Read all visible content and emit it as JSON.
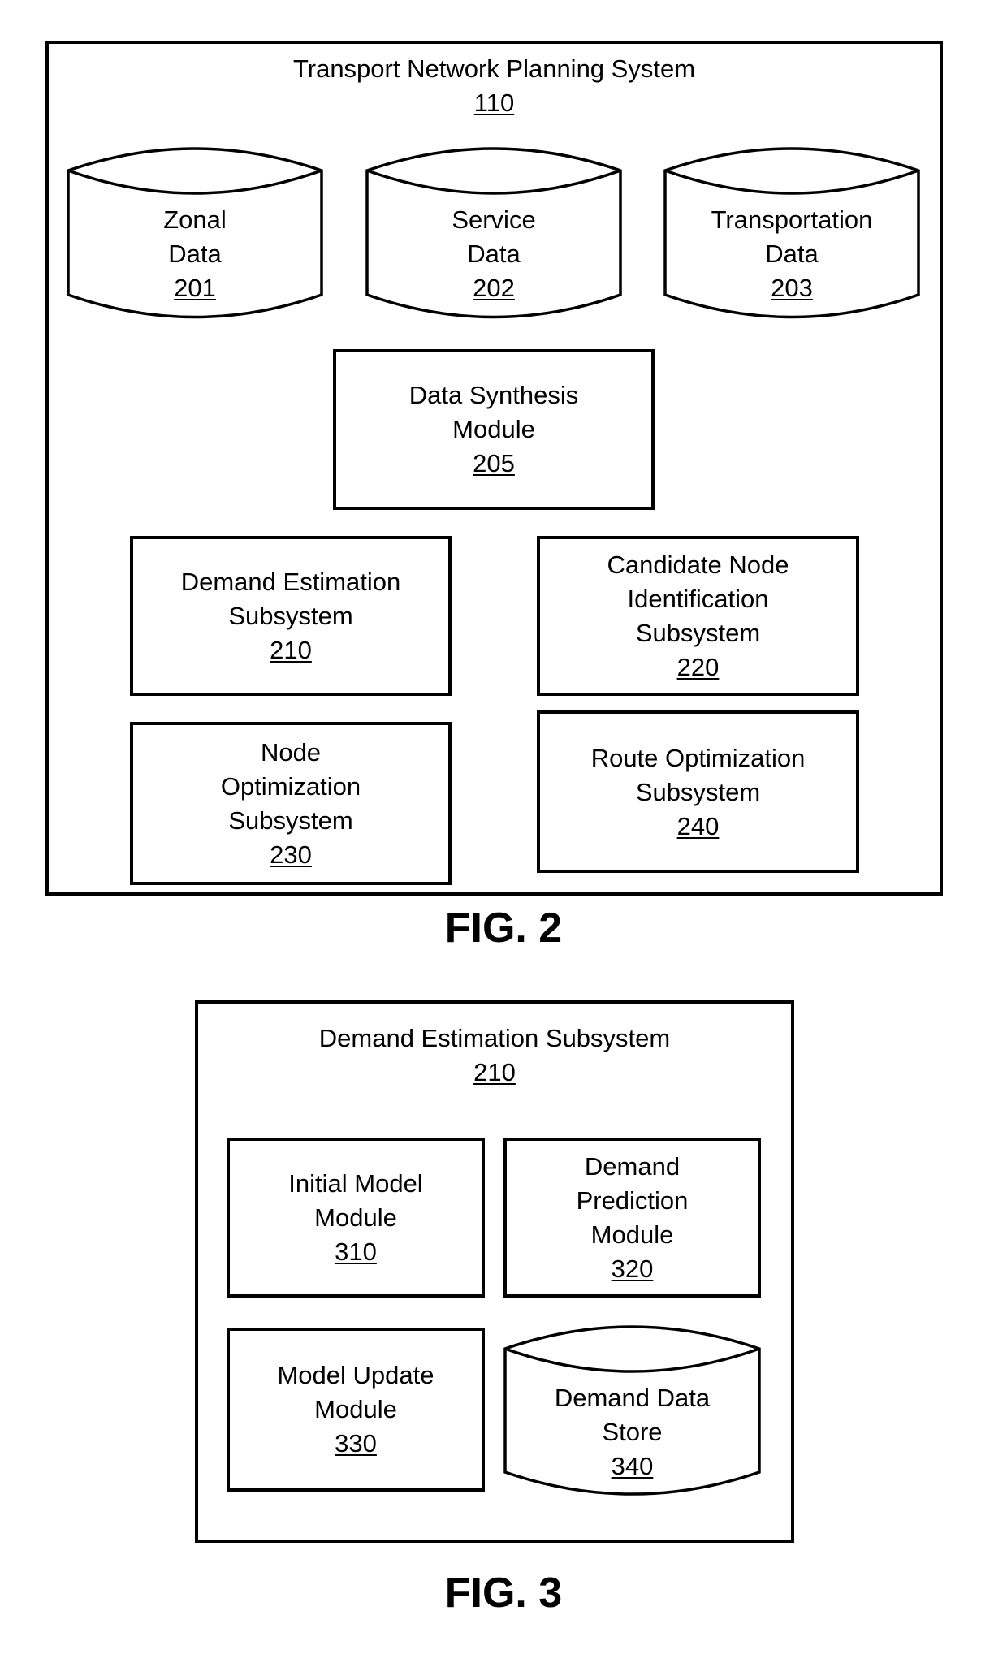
{
  "fig2": {
    "caption": "FIG. 2",
    "system": {
      "title": "Transport Network Planning System",
      "ref": "110"
    },
    "data_stores": [
      {
        "lines": [
          "Zonal",
          "Data"
        ],
        "ref": "201"
      },
      {
        "lines": [
          "Service",
          "Data"
        ],
        "ref": "202"
      },
      {
        "lines": [
          "Transportation",
          "Data"
        ],
        "ref": "203"
      }
    ],
    "synthesis_module": {
      "lines": [
        "Data Synthesis",
        "Module"
      ],
      "ref": "205"
    },
    "subsystems": [
      {
        "lines": [
          "Demand Estimation",
          "Subsystem"
        ],
        "ref": "210"
      },
      {
        "lines": [
          "Candidate Node",
          "Identification",
          "Subsystem"
        ],
        "ref": "220"
      },
      {
        "lines": [
          "Node",
          "Optimization",
          "Subsystem"
        ],
        "ref": "230"
      },
      {
        "lines": [
          "Route Optimization",
          "Subsystem"
        ],
        "ref": "240"
      }
    ]
  },
  "fig3": {
    "caption": "FIG. 3",
    "subsystem": {
      "title": "Demand Estimation Subsystem",
      "ref": "210"
    },
    "modules": [
      {
        "lines": [
          "Initial Model",
          "Module"
        ],
        "ref": "310"
      },
      {
        "lines": [
          "Demand",
          "Prediction",
          "Module"
        ],
        "ref": "320"
      },
      {
        "lines": [
          "Model Update",
          "Module"
        ],
        "ref": "330"
      }
    ],
    "data_store": {
      "lines": [
        "Demand Data",
        "Store"
      ],
      "ref": "340"
    }
  }
}
